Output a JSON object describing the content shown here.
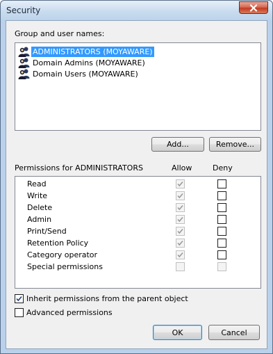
{
  "window": {
    "title": "Security"
  },
  "users": {
    "heading": "Group and user names:",
    "items": [
      {
        "name": "ADMINISTRATORS (MOYAWARE)",
        "selected": true,
        "icon": "user-group-icon"
      },
      {
        "name": "Domain Admins (MOYAWARE)",
        "selected": false,
        "icon": "user-group-icon"
      },
      {
        "name": "Domain Users (MOYAWARE)",
        "selected": false,
        "icon": "user-group-icon"
      }
    ]
  },
  "buttons": {
    "add": "Add...",
    "remove": "Remove...",
    "ok": "OK",
    "cancel": "Cancel"
  },
  "permissions": {
    "heading": "Permissions for ADMINISTRATORS",
    "allow_header": "Allow",
    "deny_header": "Deny",
    "rows": [
      {
        "name": "Read",
        "allow": true,
        "allow_enabled": false,
        "deny": false,
        "deny_enabled": true
      },
      {
        "name": "Write",
        "allow": true,
        "allow_enabled": false,
        "deny": false,
        "deny_enabled": true
      },
      {
        "name": "Delete",
        "allow": true,
        "allow_enabled": false,
        "deny": false,
        "deny_enabled": true
      },
      {
        "name": "Admin",
        "allow": true,
        "allow_enabled": false,
        "deny": false,
        "deny_enabled": true
      },
      {
        "name": "Print/Send",
        "allow": true,
        "allow_enabled": false,
        "deny": false,
        "deny_enabled": true
      },
      {
        "name": "Retention Policy",
        "allow": true,
        "allow_enabled": false,
        "deny": false,
        "deny_enabled": true
      },
      {
        "name": "Category operator",
        "allow": true,
        "allow_enabled": false,
        "deny": false,
        "deny_enabled": true
      },
      {
        "name": "Special permissions",
        "allow": false,
        "allow_enabled": false,
        "deny": false,
        "deny_enabled": false
      }
    ]
  },
  "options": {
    "inherit": {
      "label": "Inherit permissions from the parent object",
      "checked": true
    },
    "advanced": {
      "label": "Advanced permissions",
      "checked": false
    }
  },
  "colors": {
    "selection": "#3399ff",
    "title_bar": "#c9dcef",
    "close_button": "#c23b20"
  }
}
